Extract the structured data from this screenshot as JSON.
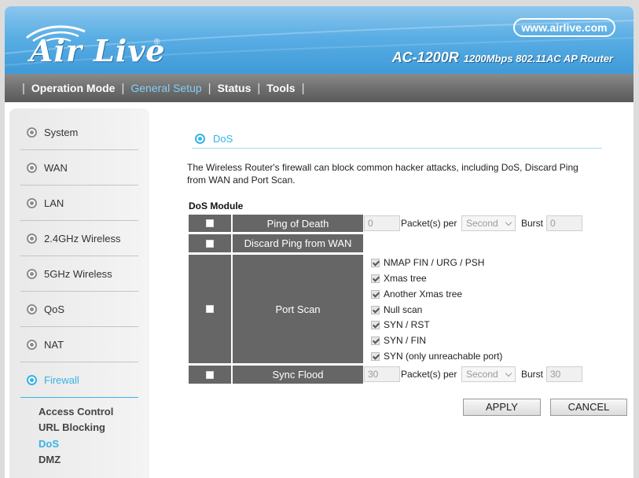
{
  "brand": {
    "logo": "Air Live",
    "logo_mark": "®",
    "url": "www.airlive.com",
    "model": "AC-1200R",
    "model_desc": "1200Mbps 802.11AC AP Router"
  },
  "nav": {
    "items": [
      "Operation Mode",
      "General Setup",
      "Status",
      "Tools"
    ],
    "active": "General Setup"
  },
  "sidebar": {
    "items": [
      "System",
      "WAN",
      "LAN",
      "2.4GHz Wireless",
      "5GHz Wireless",
      "QoS",
      "NAT",
      "Firewall"
    ],
    "active": "Firewall",
    "sub_items": [
      "Access Control",
      "URL Blocking",
      "DoS",
      "DMZ"
    ],
    "sub_active": "DoS"
  },
  "section": {
    "title": "DoS",
    "description": "The Wireless Router's firewall can block common hacker attacks, including DoS, Discard Ping from WAN and Port Scan.",
    "module_title": "DoS Module"
  },
  "dos": {
    "ping_of_death": {
      "label": "Ping of Death",
      "checked": false,
      "packets": "0",
      "per_label": "Packet(s) per",
      "unit": "Second",
      "burst_label": "Burst",
      "burst": "0"
    },
    "discard_ping": {
      "label": "Discard Ping from WAN",
      "checked": false
    },
    "port_scan": {
      "label": "Port Scan",
      "checked": false,
      "options": [
        {
          "label": "NMAP FIN / URG / PSH",
          "checked": true
        },
        {
          "label": "Xmas tree",
          "checked": true
        },
        {
          "label": "Another Xmas tree",
          "checked": true
        },
        {
          "label": "Null scan",
          "checked": true
        },
        {
          "label": "SYN / RST",
          "checked": true
        },
        {
          "label": "SYN / FIN",
          "checked": true
        },
        {
          "label": "SYN (only unreachable port)",
          "checked": true
        }
      ]
    },
    "sync_flood": {
      "label": "Sync Flood",
      "checked": false,
      "packets": "30",
      "per_label": "Packet(s) per",
      "unit": "Second",
      "burst_label": "Burst",
      "burst": "30"
    }
  },
  "buttons": {
    "apply": "APPLY",
    "cancel": "CANCEL"
  },
  "colors": {
    "header_blue": "#4aa3de",
    "accent": "#36b3e6",
    "nav_gray": "#6f6f6f",
    "table_gray": "#666666"
  }
}
